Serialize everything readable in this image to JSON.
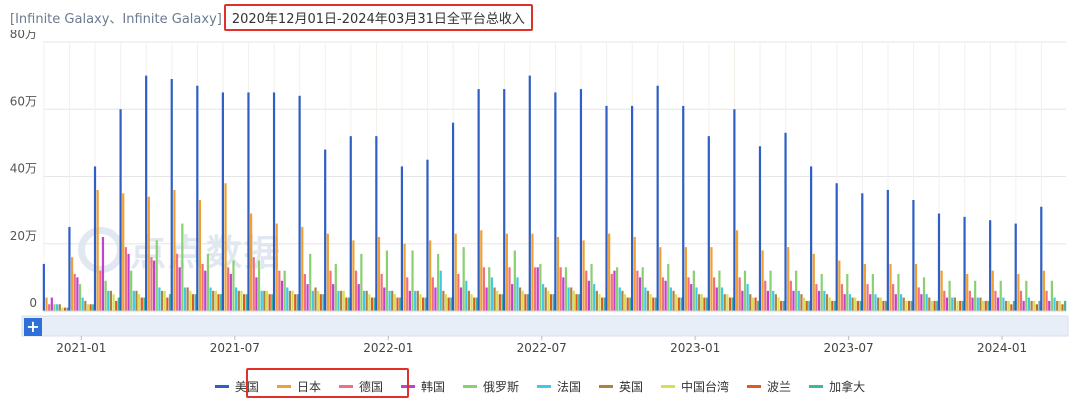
{
  "title": {
    "prefix": "[Infinite Galaxy、Infinite Galaxy]",
    "range": "2020年12月01日-2024年03月31日全平台总收入"
  },
  "watermark": {
    "text": "点点数据"
  },
  "scrollbar": {
    "plus_label": "+"
  },
  "chart_data": {
    "type": "bar",
    "title": "2020年12月01日-2024年03月31日全平台总收入",
    "y_unit": "万",
    "ylim": [
      0,
      80
    ],
    "y_ticks": [
      0,
      20,
      40,
      60,
      80
    ],
    "y_tick_labels": [
      "0",
      "20万",
      "40万",
      "60万",
      "80万"
    ],
    "x_tick_labels": [
      "2021-01",
      "2021-07",
      "2022-01",
      "2022-07",
      "2023-01",
      "2023-07",
      "2024-01"
    ],
    "x_tick_index": [
      1,
      7,
      13,
      19,
      25,
      31,
      37
    ],
    "grid": true,
    "legend_position": "bottom-center",
    "categories": [
      "2020-12",
      "2021-01",
      "2021-02",
      "2021-03",
      "2021-04",
      "2021-05",
      "2021-06",
      "2021-07",
      "2021-08",
      "2021-09",
      "2021-10",
      "2021-11",
      "2021-12",
      "2022-01",
      "2022-02",
      "2022-03",
      "2022-04",
      "2022-05",
      "2022-06",
      "2022-07",
      "2022-08",
      "2022-09",
      "2022-10",
      "2022-11",
      "2022-12",
      "2023-01",
      "2023-02",
      "2023-03",
      "2023-04",
      "2023-05",
      "2023-06",
      "2023-07",
      "2023-08",
      "2023-09",
      "2023-10",
      "2023-11",
      "2023-12",
      "2024-01",
      "2024-02",
      "2024-03"
    ],
    "series": [
      {
        "name": "美国",
        "color": "#2f5fc4",
        "values": [
          14,
          25,
          43,
          60,
          70,
          69,
          67,
          65,
          65,
          65,
          64,
          48,
          52,
          52,
          43,
          45,
          56,
          66,
          66,
          70,
          65,
          66,
          61,
          61,
          67,
          61,
          52,
          60,
          49,
          53,
          43,
          38,
          35,
          36,
          33,
          29,
          28,
          27,
          26,
          31
        ]
      },
      {
        "name": "日本",
        "color": "#f0a030",
        "values": [
          4,
          16,
          36,
          35,
          34,
          36,
          33,
          38,
          29,
          26,
          25,
          23,
          21,
          22,
          20,
          21,
          23,
          24,
          23,
          23,
          22,
          21,
          23,
          22,
          19,
          19,
          19,
          24,
          18,
          19,
          17,
          15,
          14,
          14,
          14,
          12,
          11,
          12,
          11,
          12
        ]
      },
      {
        "name": "德国",
        "color": "#f07080",
        "values": [
          2,
          11,
          12,
          19,
          16,
          17,
          14,
          13,
          16,
          12,
          11,
          12,
          12,
          11,
          10,
          10,
          11,
          13,
          13,
          13,
          13,
          12,
          11,
          12,
          10,
          10,
          10,
          10,
          9,
          9,
          8,
          8,
          8,
          8,
          7,
          6,
          6,
          6,
          6,
          6
        ]
      },
      {
        "name": "韩国",
        "color": "#c040d0",
        "values": [
          4,
          10,
          22,
          17,
          15,
          13,
          12,
          11,
          10,
          9,
          8,
          8,
          8,
          7,
          6,
          7,
          7,
          7,
          8,
          13,
          10,
          9,
          12,
          10,
          9,
          8,
          7,
          6,
          6,
          6,
          6,
          5,
          5,
          5,
          5,
          4,
          4,
          4,
          3,
          3
        ]
      },
      {
        "name": "俄罗斯",
        "color": "#88d070",
        "values": [
          2,
          8,
          9,
          12,
          21,
          26,
          17,
          15,
          15,
          12,
          17,
          14,
          17,
          18,
          18,
          17,
          19,
          13,
          18,
          14,
          13,
          14,
          13,
          13,
          14,
          12,
          12,
          12,
          12,
          12,
          11,
          11,
          11,
          11,
          10,
          9,
          9,
          9,
          9,
          9
        ]
      },
      {
        "name": "法国",
        "color": "#40c8e8",
        "values": [
          2,
          4,
          6,
          6,
          7,
          7,
          7,
          7,
          6,
          7,
          6,
          6,
          6,
          6,
          6,
          12,
          9,
          10,
          10,
          8,
          7,
          8,
          7,
          7,
          7,
          7,
          7,
          8,
          6,
          6,
          6,
          5,
          5,
          5,
          5,
          4,
          4,
          4,
          4,
          4
        ]
      },
      {
        "name": "英国",
        "color": "#b08040",
        "values": [
          2,
          3,
          6,
          6,
          6,
          7,
          6,
          6,
          6,
          6,
          7,
          6,
          6,
          6,
          6,
          6,
          6,
          7,
          7,
          7,
          7,
          6,
          6,
          6,
          6,
          5,
          5,
          5,
          5,
          5,
          5,
          4,
          4,
          4,
          4,
          4,
          4,
          3,
          3,
          3
        ]
      },
      {
        "name": "中国台湾",
        "color": "#d8e050",
        "values": [
          1,
          2,
          5,
          5,
          6,
          6,
          6,
          6,
          6,
          6,
          6,
          6,
          5,
          5,
          5,
          5,
          5,
          6,
          6,
          6,
          6,
          5,
          5,
          5,
          5,
          5,
          5,
          4,
          4,
          4,
          4,
          4,
          4,
          3,
          3,
          3,
          3,
          3,
          3,
          3
        ]
      },
      {
        "name": "波兰",
        "color": "#e05a20",
        "values": [
          1,
          2,
          3,
          4,
          4,
          5,
          5,
          5,
          5,
          5,
          5,
          4,
          4,
          4,
          4,
          4,
          4,
          5,
          5,
          5,
          5,
          4,
          4,
          4,
          4,
          4,
          4,
          4,
          3,
          3,
          3,
          3,
          3,
          3,
          3,
          3,
          3,
          2,
          2,
          2
        ]
      },
      {
        "name": "加拿大",
        "color": "#3ab8a0",
        "values": [
          1,
          2,
          4,
          4,
          5,
          5,
          5,
          5,
          5,
          5,
          5,
          4,
          4,
          4,
          4,
          4,
          4,
          5,
          5,
          5,
          5,
          4,
          4,
          4,
          4,
          4,
          4,
          3,
          3,
          3,
          3,
          3,
          3,
          3,
          3,
          3,
          3,
          3,
          3,
          3
        ]
      }
    ]
  }
}
